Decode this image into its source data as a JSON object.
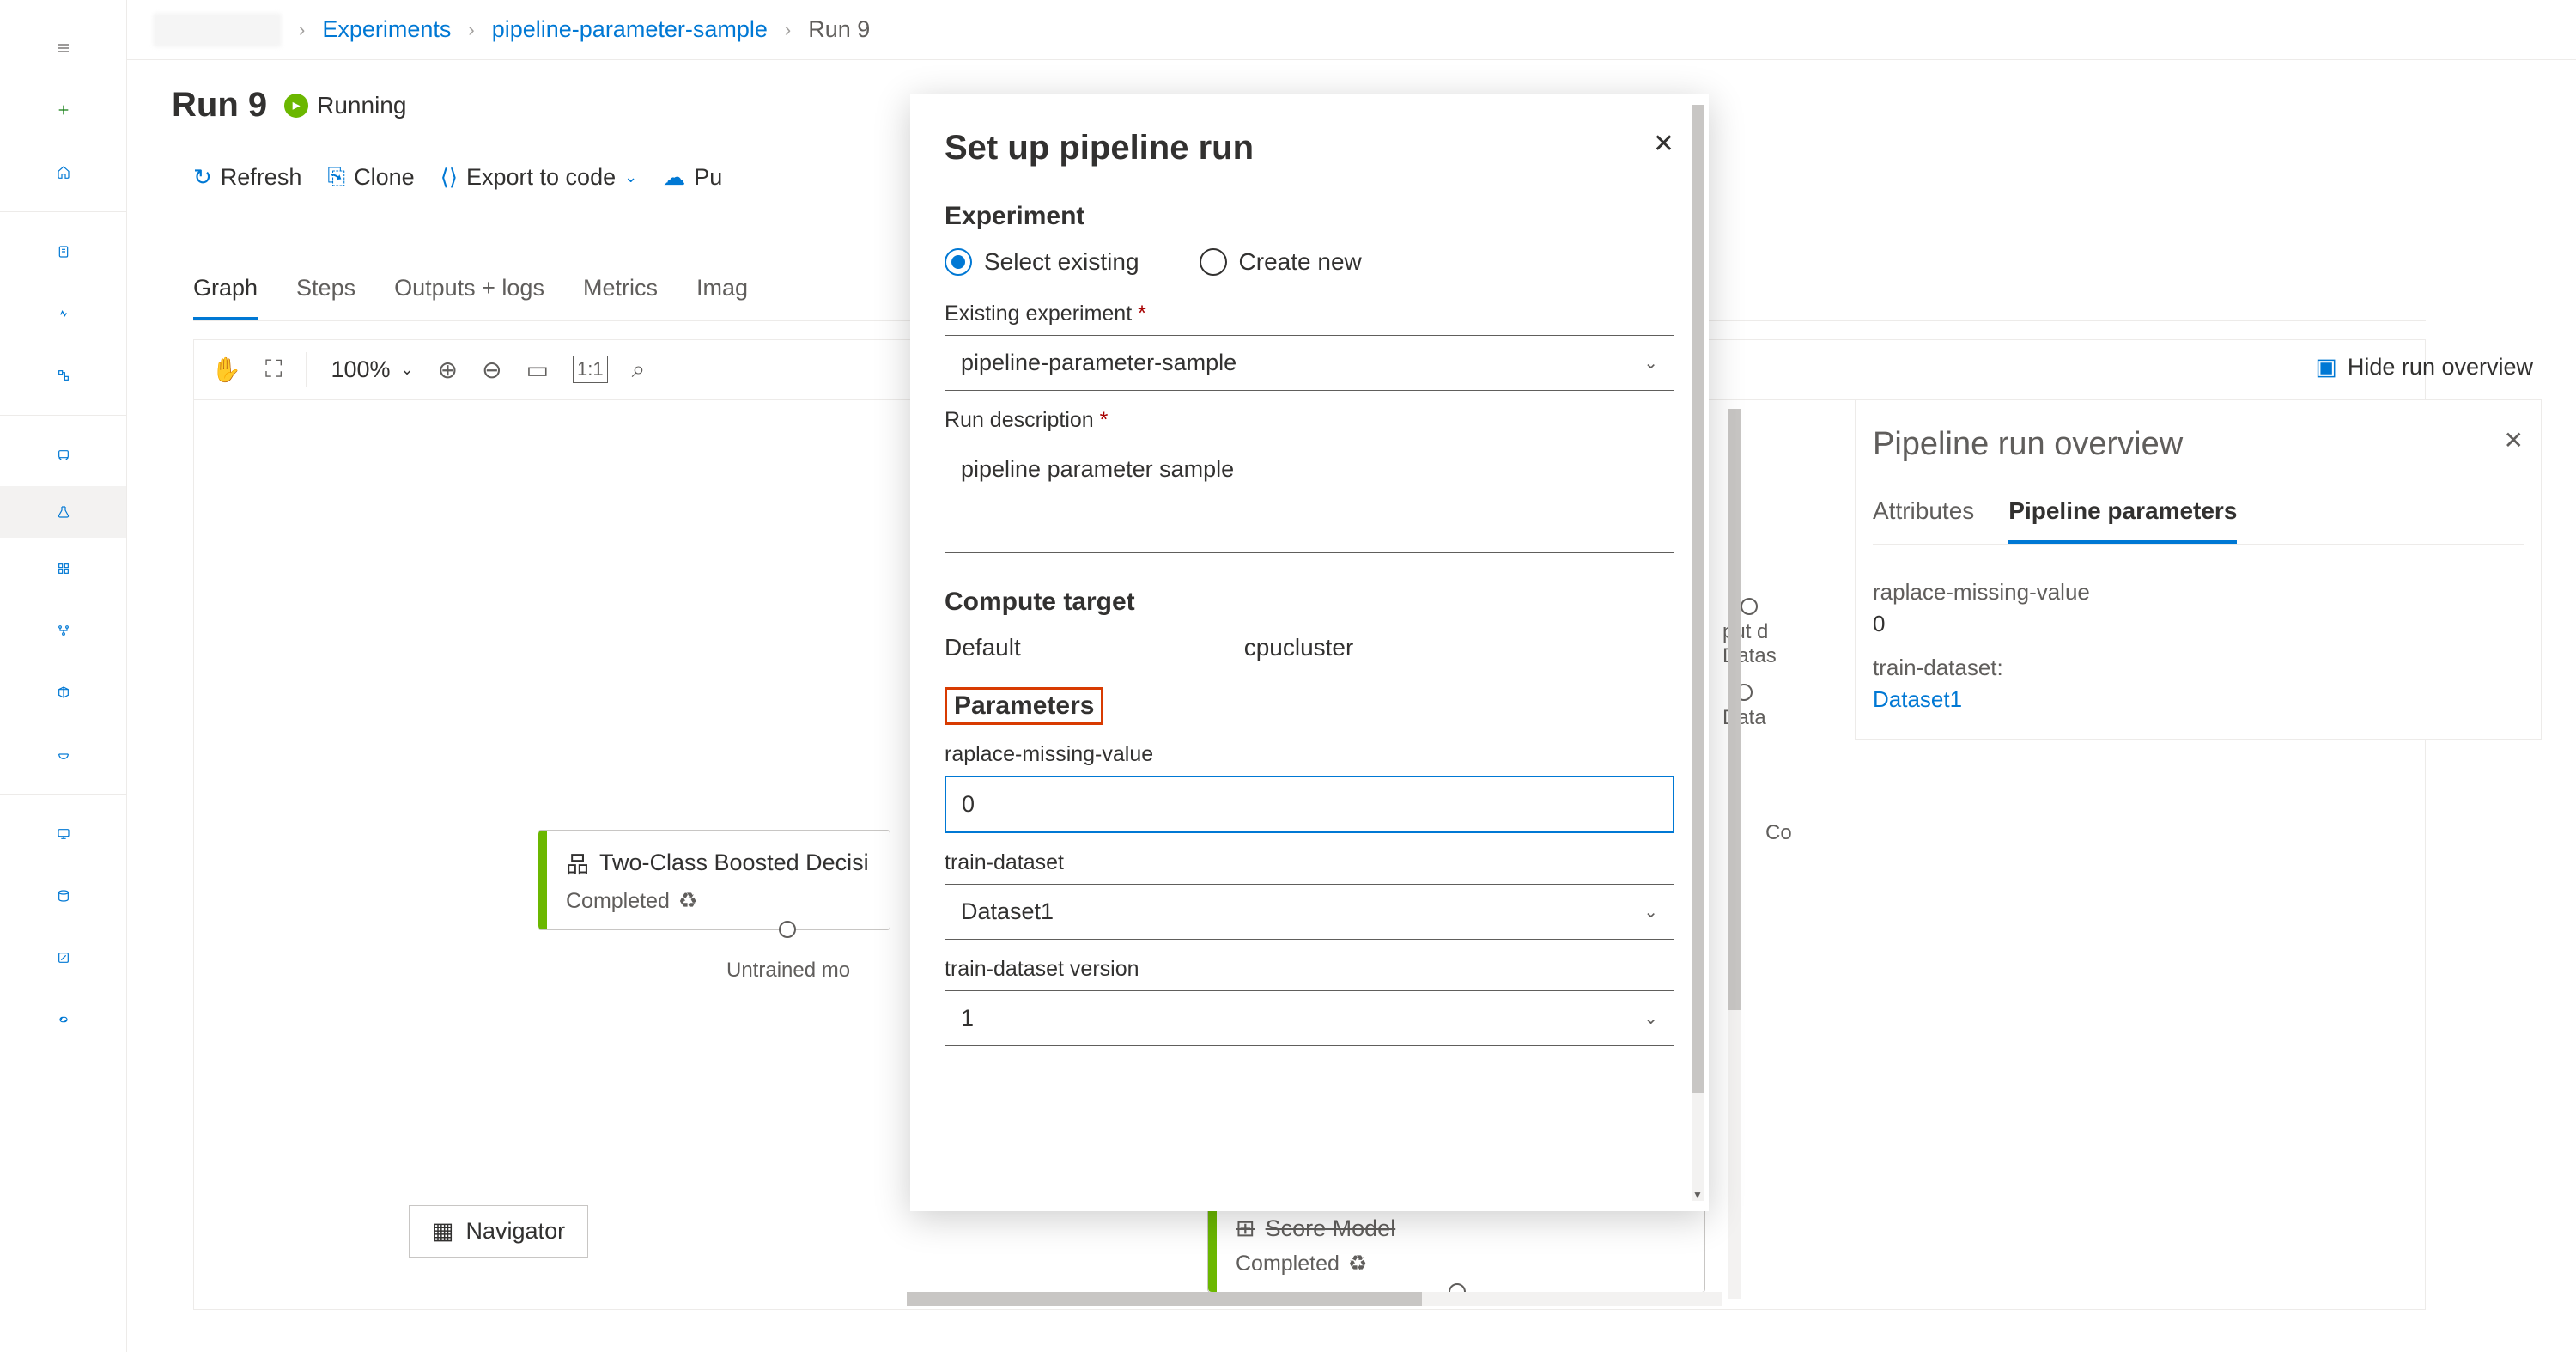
{
  "breadcrumb": {
    "experiments": "Experiments",
    "pipeline": "pipeline-parameter-sample",
    "run": "Run 9"
  },
  "header": {
    "title": "Run 9",
    "status": "Running"
  },
  "toolbar": {
    "refresh": "Refresh",
    "clone": "Clone",
    "export": "Export to code",
    "publish": "Pu"
  },
  "tabs": {
    "graph": "Graph",
    "steps": "Steps",
    "outputs": "Outputs + logs",
    "metrics": "Metrics",
    "images": "Imag"
  },
  "canvasToolbar": {
    "zoom": "100%"
  },
  "hideOverview": "Hide run overview",
  "modules": {
    "boosted": {
      "title": "Two-Class Boosted Decisi",
      "status": "Completed",
      "portLabel": "Untrained mo"
    },
    "score": {
      "title": "Score Model",
      "status": "Completed"
    },
    "outputPort1": "put d",
    "outputPort1b": "Datas",
    "outputPort2": "Data",
    "outputPort3": "Co"
  },
  "navigator": "Navigator",
  "overview": {
    "title": "Pipeline run overview",
    "tabs": {
      "attributes": "Attributes",
      "parameters": "Pipeline parameters"
    },
    "params": {
      "p1label": "raplace-missing-value",
      "p1value": "0",
      "p2label": "train-dataset:",
      "p2value": "Dataset1"
    }
  },
  "modal": {
    "title": "Set up pipeline run",
    "experiment_section": "Experiment",
    "radio_existing": "Select existing",
    "radio_new": "Create new",
    "existing_exp_label": "Existing experiment",
    "existing_exp_value": "pipeline-parameter-sample",
    "run_desc_label": "Run description",
    "run_desc_value": "pipeline parameter sample",
    "compute_section": "Compute target",
    "compute_default": "Default",
    "compute_value": "cpucluster",
    "parameters_section": "Parameters",
    "param1_label": "raplace-missing-value",
    "param1_value": "0",
    "param2_label": "train-dataset",
    "param2_value": "Dataset1",
    "param3_label": "train-dataset version",
    "param3_value": "1"
  }
}
